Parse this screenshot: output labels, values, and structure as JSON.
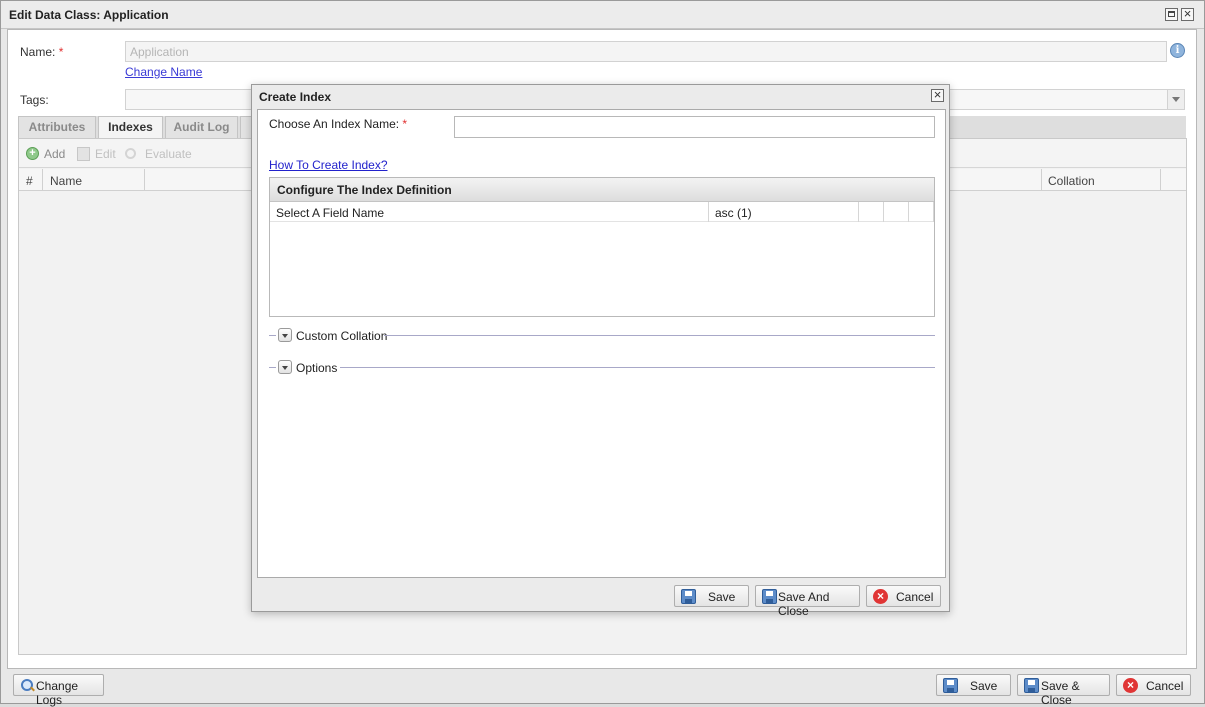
{
  "window": {
    "title": "Edit Data Class: Application",
    "name_label": "Name:",
    "required_mark": "*",
    "name_value": "Application",
    "change_name_link": "Change Name",
    "tags_label": "Tags:",
    "tabs": [
      {
        "label": "Attributes"
      },
      {
        "label": "Indexes"
      },
      {
        "label": "Audit Log"
      }
    ],
    "toolbar": {
      "add": "Add",
      "edit": "Edit",
      "evaluate": "Evaluate"
    },
    "grid_headers": {
      "num": "#",
      "name": "Name",
      "collation": "Collation"
    },
    "footer": {
      "change_logs": "Change Logs",
      "save": "Save",
      "save_close": "Save & Close",
      "cancel": "Cancel"
    }
  },
  "dialog": {
    "title": "Create Index",
    "index_name_label": "Choose An Index Name:",
    "required_mark": "*",
    "index_name_value": "",
    "help_link": "How To Create Index?",
    "definition_panel_title": "Configure The Index Definition",
    "definition_rows": [
      {
        "field": "Select A Field Name",
        "order": "asc (1)"
      }
    ],
    "custom_collation_label": "Custom Collation",
    "options_label": "Options",
    "buttons": {
      "save": "Save",
      "save_and_close": "Save And Close",
      "cancel": "Cancel"
    }
  },
  "colors": {
    "link": "#3a3ad6",
    "required": "#e03030",
    "cancel_icon": "#e03535",
    "save_icon": "#5d8cc9"
  },
  "icons": [
    "maximize-icon",
    "close-icon",
    "info-icon",
    "add-icon",
    "edit-icon",
    "evaluate-icon",
    "save-icon",
    "cancel-icon",
    "search-icon",
    "expand-toggle-icon"
  ]
}
